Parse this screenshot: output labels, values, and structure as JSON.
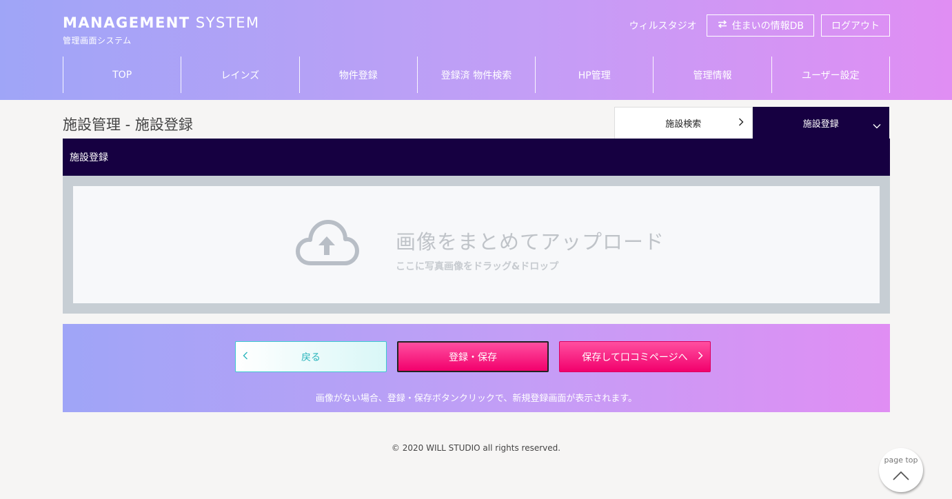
{
  "header": {
    "brand_bold": "MANAGEMENT",
    "brand_light": "SYSTEM",
    "brand_sub": "管理画面システム",
    "user_name": "ウィルスタジオ",
    "db_button": "住まいの情報DB",
    "db_icon": "swap-arrows-icon",
    "logout_button": "ログアウト",
    "gradient_colors": [
      "#9fa5f7",
      "#c39ef6",
      "#e08ef3"
    ]
  },
  "nav": {
    "items": [
      "TOP",
      "レインズ",
      "物件登録",
      "登録済 物件検索",
      "HP管理",
      "管理情報",
      "ユーザー設定"
    ]
  },
  "page": {
    "title": "施設管理 - 施設登録",
    "tabs": [
      {
        "label": "施設検索",
        "icon": "chevron-right-icon",
        "active": false
      },
      {
        "label": "施設登録",
        "icon": "chevron-down-icon",
        "active": true
      }
    ],
    "panel_title": "施設登録",
    "panel_color": "#160041"
  },
  "upload": {
    "main": "画像をまとめてアップロード",
    "sub": "ここに写真画像をドラッグ&ドロップ",
    "icon": "cloud-upload-icon"
  },
  "actions": {
    "back": "戻る",
    "save": "登録・保存",
    "next": "保存して口コミページへ",
    "note": "画像がない場合、登録・保存ボタンクリックで、新規登録画面が表示されます。",
    "accent_pink": "#f2006c",
    "accent_teal": "#3cc9cf"
  },
  "footer": {
    "copyright": "© 2020 WILL STUDIO all rights reserved.",
    "page_top": "page top"
  }
}
